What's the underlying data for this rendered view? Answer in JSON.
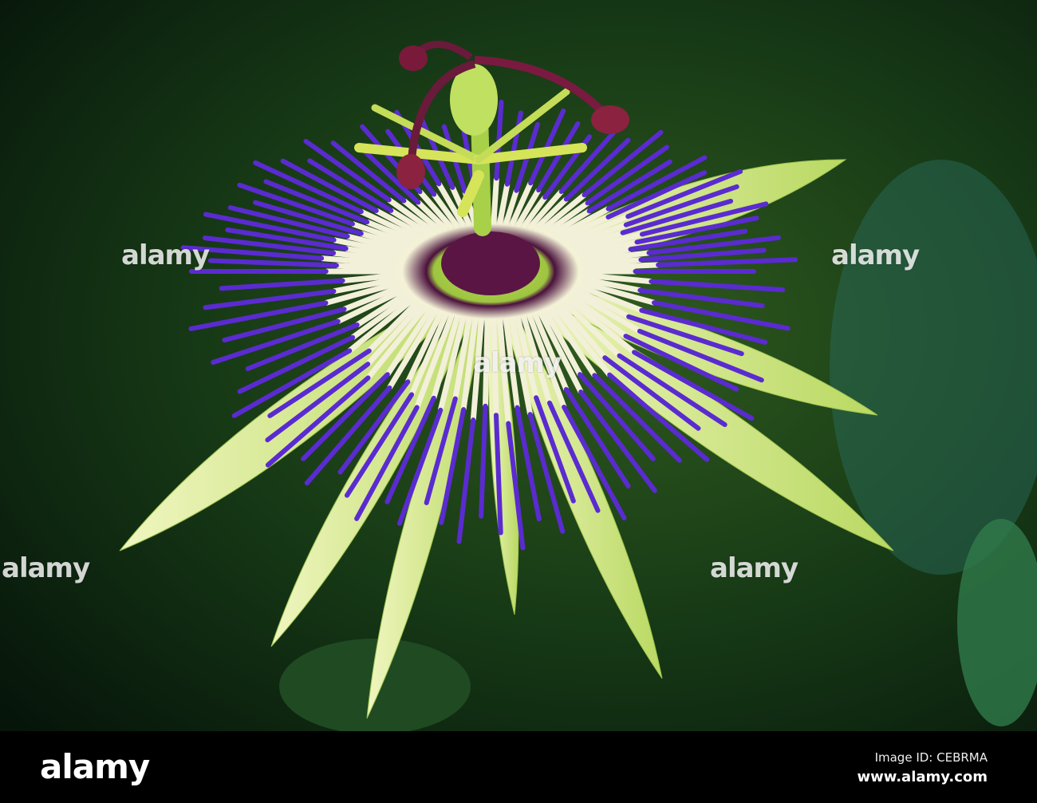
{
  "photo": {
    "subject": "passion flower",
    "watermark_text": "alamy",
    "colors": {
      "background": "#0f2a12",
      "petal": "#d8ec9a",
      "filament": "#5a2bd0",
      "center": "#9fc84a",
      "stigma": "#7a1a3a"
    }
  },
  "footer": {
    "logo": "alamy",
    "image_id": "Image ID: CEBRMA",
    "url": "www.alamy.com"
  }
}
